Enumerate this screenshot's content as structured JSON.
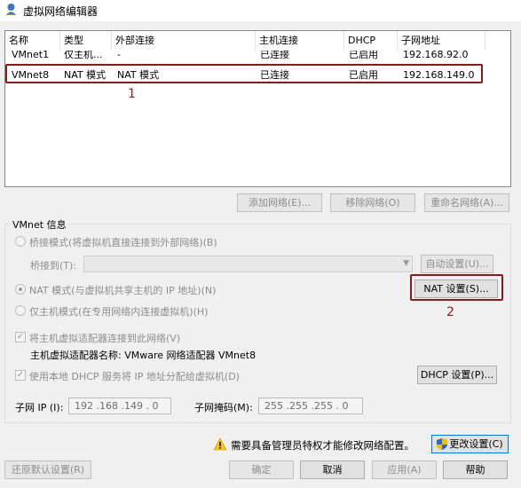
{
  "window": {
    "title": "虚拟网络编辑器"
  },
  "table": {
    "headers": [
      "名称",
      "类型",
      "外部连接",
      "主机连接",
      "DHCP",
      "子网地址"
    ],
    "rows": [
      [
        "VMnet1",
        "仅主机...",
        "-",
        "已连接",
        "已启用",
        "192.168.92.0"
      ],
      [
        "VMnet8",
        "NAT 模式",
        "NAT 模式",
        "已连接",
        "已启用",
        "192.168.149.0"
      ]
    ]
  },
  "table_buttons": {
    "add": "添加网络(E)...",
    "remove": "移除网络(O)",
    "rename": "重命名网络(A)..."
  },
  "annotations": {
    "one": "1",
    "two": "2"
  },
  "vmnet_info": {
    "legend": "VMnet 信息",
    "bridge_mode": "桥接模式(将虚拟机直接连接到外部网络)(B)",
    "bridge_to_label": "桥接到(T):",
    "bridge_to_value": "",
    "auto_settings": "自动设置(U)...",
    "nat_mode": "NAT 模式(与虚拟机共享主机的 IP 地址)(N)",
    "nat_settings": "NAT 设置(S)...",
    "host_only_mode": "仅主机模式(在专用网络内连接虚拟机)(H)",
    "connect_adapter": "将主机虚拟适配器连接到此网络(V)",
    "adapter_name_label": "主机虚拟适配器名称: VMware 网络适配器 VMnet8",
    "use_dhcp": "使用本地 DHCP 服务将 IP 地址分配给虚拟机(D)",
    "dhcp_settings": "DHCP 设置(P)...",
    "subnet_ip_label": "子网 IP (I):",
    "subnet_ip_value": "192 .168 .149 . 0",
    "subnet_mask_label": "子网掩码(M):",
    "subnet_mask_value": "255 .255 .255 . 0"
  },
  "admin_notice": "需要具备管理员特权才能修改网络配置。",
  "change_settings": "更改设置(C)",
  "footer_buttons": {
    "restore": "还原默认设置(R)",
    "ok": "确定",
    "cancel": "取消",
    "apply": "应用(A)",
    "help": "帮助"
  }
}
